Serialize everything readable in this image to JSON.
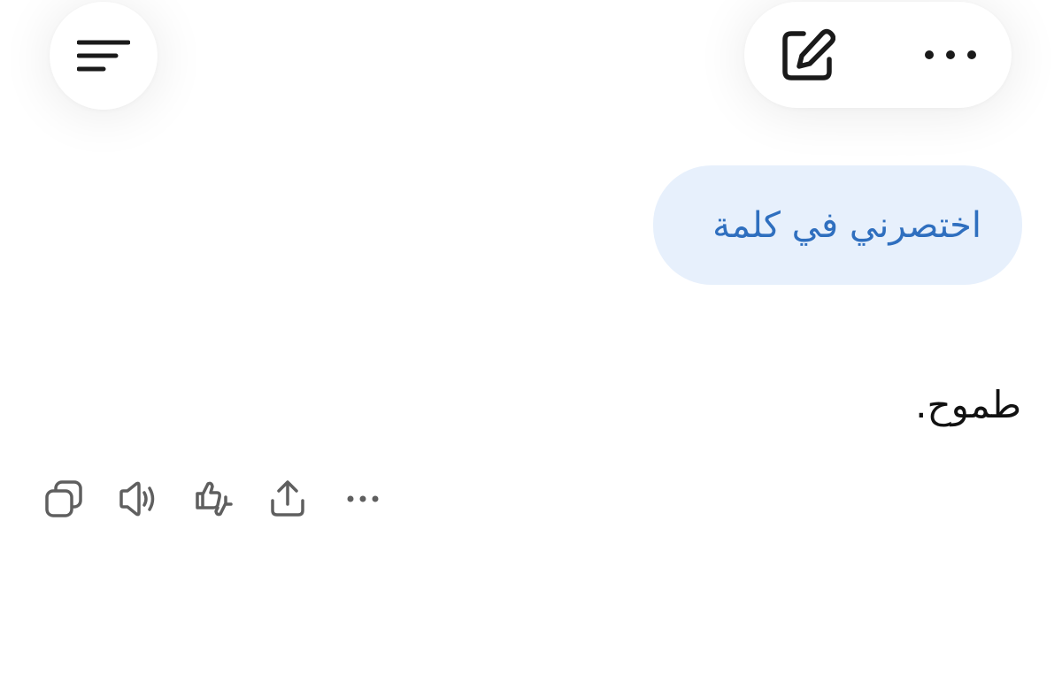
{
  "header": {
    "menu_icon": "menu-lines-icon",
    "compose_icon": "edit-pen-icon",
    "more_icon": "more-horizontal-icon"
  },
  "conversation": {
    "user_message": "اختصرني في كلمة",
    "assistant_reply": "طموح."
  },
  "message_actions": {
    "icons": [
      "copy-icon",
      "read-aloud-icon",
      "feedback-thumbs-icon",
      "share-icon",
      "more-horizontal-icon"
    ]
  },
  "colors": {
    "user_bubble_bg": "#e7f0fc",
    "user_text": "#2f6fbf",
    "assistant_text": "#111111",
    "icon_dark": "#1a1a1a",
    "icon_muted": "#5f5f5f"
  }
}
